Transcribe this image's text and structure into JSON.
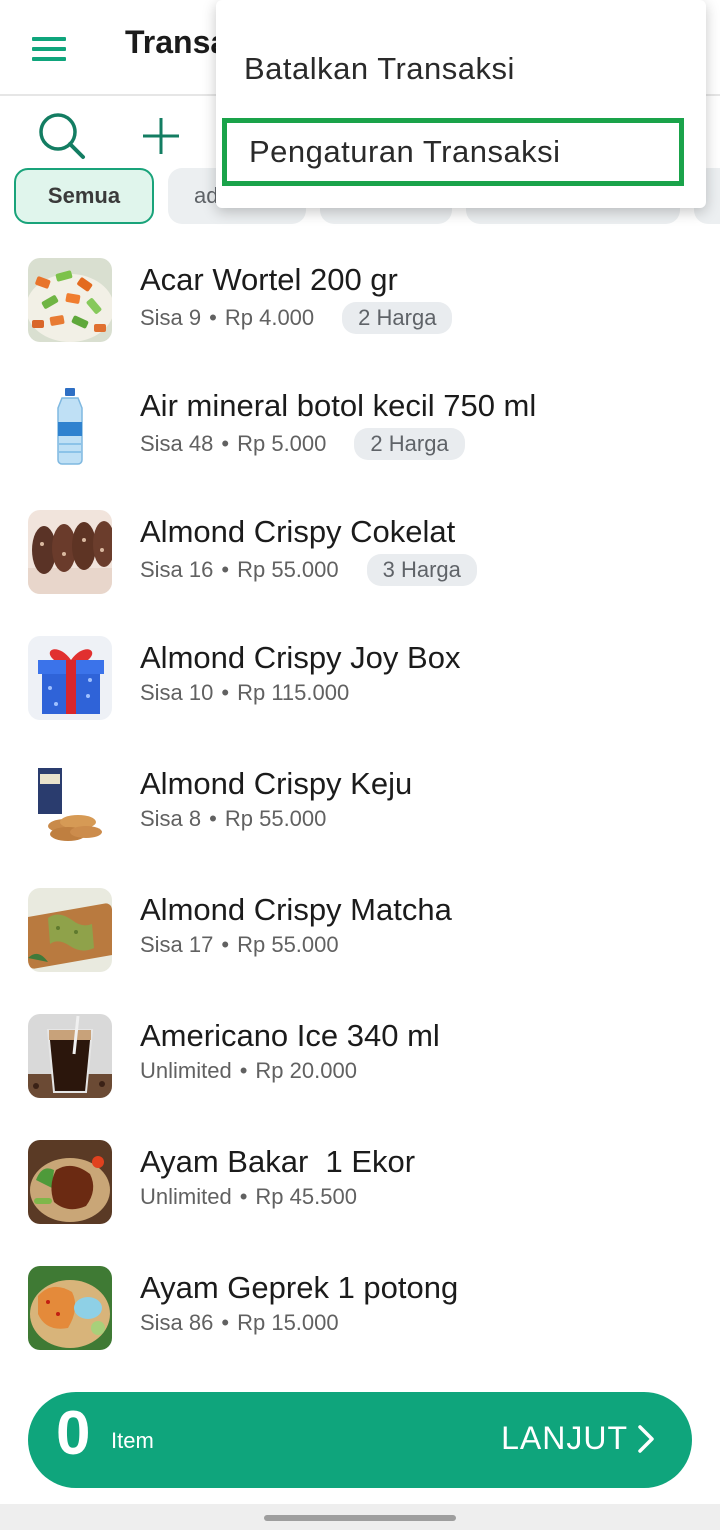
{
  "header": {
    "title": "Transa"
  },
  "chips": [
    {
      "label": "Semua",
      "active": true
    },
    {
      "label": "ad",
      "active": false
    },
    {
      "label": "",
      "active": false
    },
    {
      "label": "",
      "active": false
    },
    {
      "label": "",
      "active": false
    }
  ],
  "menu": {
    "items": [
      {
        "label": "Batalkan Transaksi"
      },
      {
        "label": "Pengaturan Transaksi",
        "highlighted": true
      }
    ]
  },
  "products": [
    {
      "name": "Acar Wortel 200 gr",
      "stock": "Sisa 9",
      "price": "Rp 4.000",
      "badge": "2 Harga",
      "thumb": "carrot-pickle"
    },
    {
      "name": "Air mineral botol kecil 750 ml",
      "stock": "Sisa 48",
      "price": "Rp 5.000",
      "badge": "2 Harga",
      "thumb": "water-bottle"
    },
    {
      "name": "Almond Crispy Cokelat",
      "stock": "Sisa 16",
      "price": "Rp 55.000",
      "badge": "3 Harga",
      "thumb": "chocolate-cookies"
    },
    {
      "name": "Almond Crispy Joy Box",
      "stock": "Sisa 10",
      "price": "Rp 115.000",
      "badge": "",
      "thumb": "gift-box"
    },
    {
      "name": "Almond Crispy Keju",
      "stock": "Sisa 8",
      "price": "Rp 55.000",
      "badge": "",
      "thumb": "cheese-cookies"
    },
    {
      "name": "Almond Crispy Matcha",
      "stock": "Sisa 17",
      "price": "Rp 55.000",
      "badge": "",
      "thumb": "matcha-cookies"
    },
    {
      "name": "Americano Ice 340 ml",
      "stock": "Unlimited",
      "price": "Rp 20.000",
      "badge": "",
      "thumb": "iced-coffee"
    },
    {
      "name": "Ayam Bakar  1 Ekor",
      "stock": "Unlimited",
      "price": "Rp 45.500",
      "badge": "",
      "thumb": "grilled-chicken"
    },
    {
      "name": "Ayam Geprek 1 potong",
      "stock": "Sisa 86",
      "price": "Rp 15.000",
      "badge": "",
      "thumb": "fried-chicken"
    }
  ],
  "checkout": {
    "count": "0",
    "count_label": "Item",
    "action_label": "LANJUT"
  },
  "colors": {
    "primary": "#0fa57c",
    "highlight_border": "#1aa34a",
    "chip_active_bg": "#e0f5ec"
  },
  "icons": {
    "menu": "hamburger-icon",
    "search": "search-icon",
    "add": "plus-icon",
    "next": "chevron-right-icon"
  }
}
